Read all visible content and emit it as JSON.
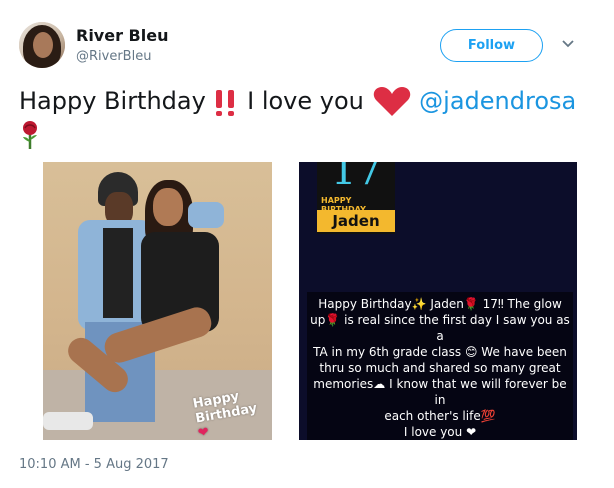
{
  "user": {
    "name": "River Bleu",
    "handle": "@RiverBleu"
  },
  "actions": {
    "follow_label": "Follow"
  },
  "tweet": {
    "text_prefix": "Happy Birthday",
    "text_mid": "I love you",
    "mention": "@jadendrosa"
  },
  "media": {
    "photo1_caption_line1": "Happy",
    "photo1_caption_line2": "Birthday",
    "photo2_badge_number": "17",
    "photo2_badge_title": "HAPPY BIRTHDAY",
    "photo2_badge_name": "Jaden",
    "photo2_message": [
      "Happy Birthday✨ Jaden🌹 17‼ The glow",
      "up🌹 is real since the first day I saw you as a",
      "TA in my 6th grade class 😊 We have been",
      "thru so much and shared so many great",
      "memories☁ I know that we will forever be in",
      "each other's life💯",
      "I love you ❤"
    ]
  },
  "meta": {
    "timestamp": "10:10 AM - 5 Aug 2017"
  },
  "colors": {
    "accent": "#1da1f2",
    "mention": "#1b95e0",
    "heart": "#e0245e",
    "secondary_text": "#657786"
  }
}
